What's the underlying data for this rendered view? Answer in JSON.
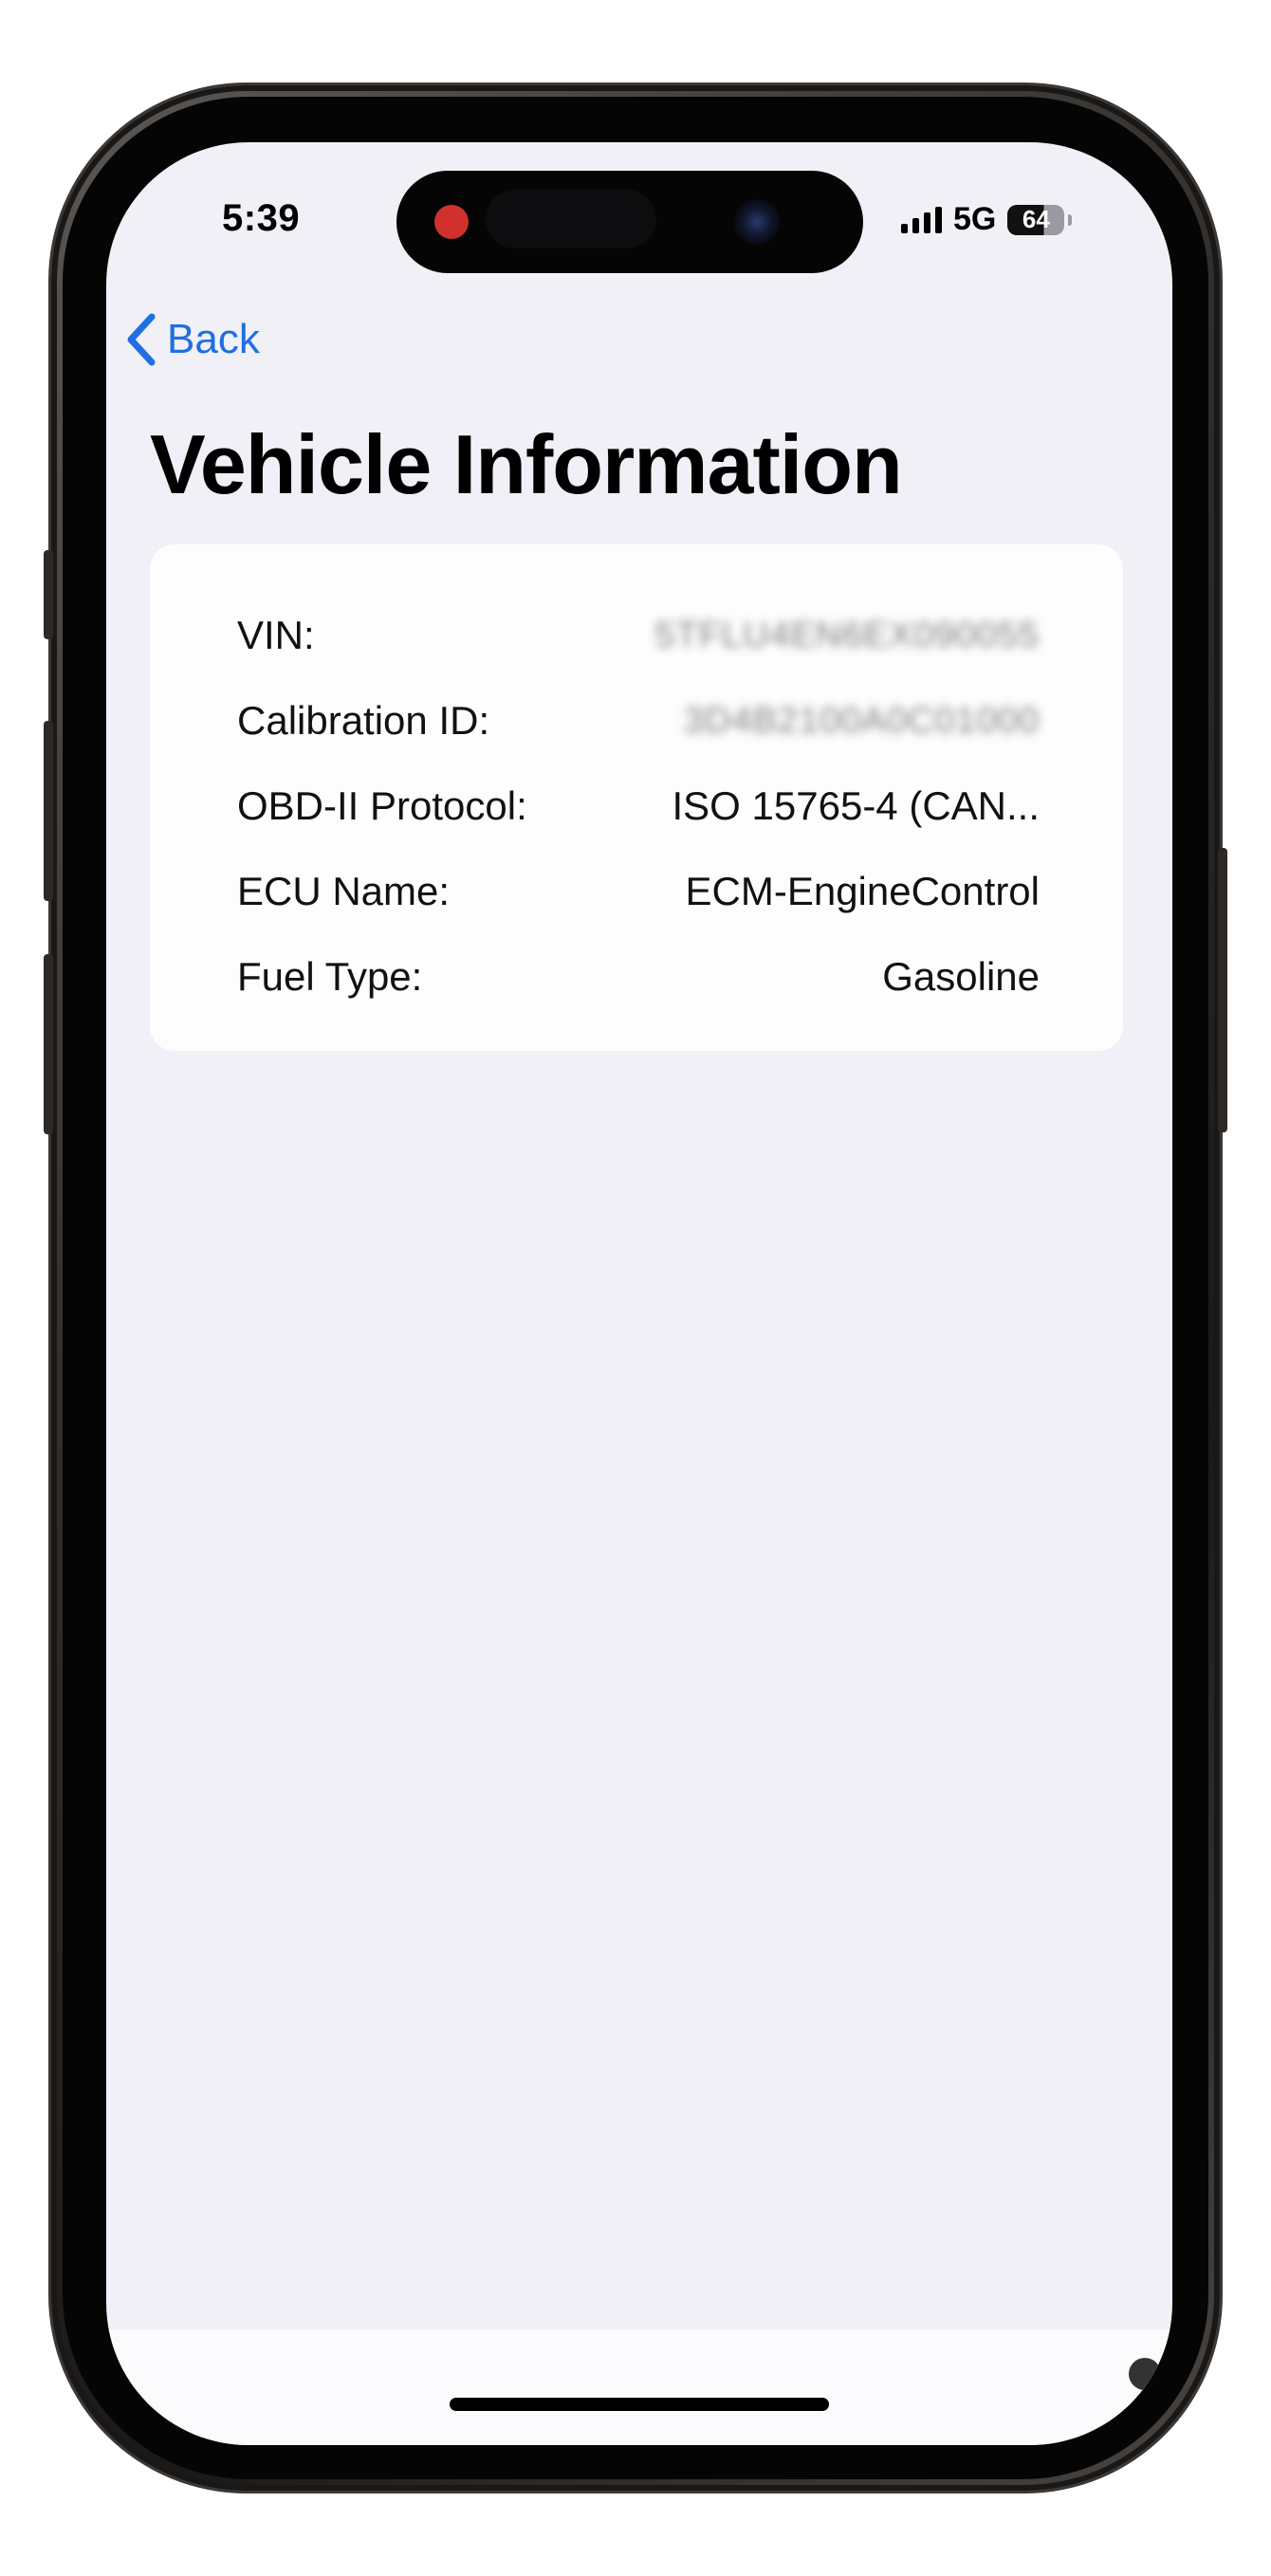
{
  "status_bar": {
    "time": "5:39",
    "network": "5G",
    "battery": "64",
    "recording_color": "#d0312d"
  },
  "nav": {
    "back_label": "Back",
    "back_icon": "chevron-left-icon",
    "accent_color": "#1f6fe0"
  },
  "page": {
    "title": "Vehicle Information"
  },
  "vehicle_info": {
    "rows": [
      {
        "label": "VIN:",
        "value": "5TFLU4EN6EX090055"
      },
      {
        "label": "Calibration ID:",
        "value": "3D4B2100A0C01000"
      },
      {
        "label": "OBD-II Protocol:",
        "value": "ISO 15765-4 (CAN..."
      },
      {
        "label": "ECU Name:",
        "value": "ECM-EngineControl"
      },
      {
        "label": "Fuel Type:",
        "value": "Gasoline"
      }
    ]
  }
}
